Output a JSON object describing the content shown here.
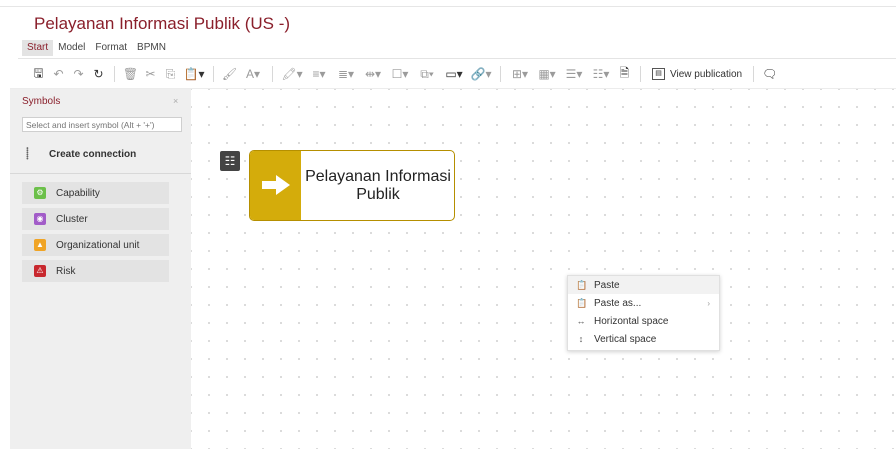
{
  "window": {
    "title": "Pelayanan Informasi Publik (US -)"
  },
  "menu": {
    "items": [
      "Start",
      "Model",
      "Format",
      "BPMN"
    ],
    "active": "Start"
  },
  "toolbar": {
    "view_publication_label": "View publication"
  },
  "sidebar": {
    "title": "Symbols",
    "close": "×",
    "search_placeholder": "Select and insert symbol (Alt + '+')",
    "create_connection_label": "Create connection",
    "symbols": [
      {
        "label": "Capability",
        "icon": "capability-icon",
        "color": "#6cc04a"
      },
      {
        "label": "Cluster",
        "icon": "cluster-icon",
        "color": "#a25cc8"
      },
      {
        "label": "Organizational unit",
        "icon": "org-unit-icon",
        "color": "#f0a425"
      },
      {
        "label": "Risk",
        "icon": "risk-icon",
        "color": "#c8282e"
      }
    ]
  },
  "canvas": {
    "process_node": {
      "label_line1": "Pelayanan Informasi",
      "label_line2": "Publik",
      "color": "#d4ac0b"
    }
  },
  "context_menu": {
    "items": [
      {
        "label": "Paste",
        "icon": "paste-icon",
        "highlighted": true
      },
      {
        "label": "Paste as...",
        "icon": "paste-as-icon",
        "submenu": true
      },
      {
        "label": "Horizontal space",
        "icon": "horizontal-space-icon"
      },
      {
        "label": "Vertical space",
        "icon": "vertical-space-icon"
      }
    ]
  }
}
